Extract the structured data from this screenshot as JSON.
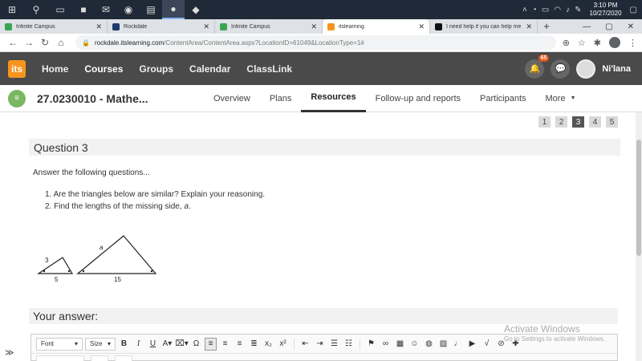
{
  "taskbar": {
    "clock_time": "3:10 PM",
    "clock_date": "10/27/2020"
  },
  "browser": {
    "tabs": [
      {
        "title": "Infinite Campus",
        "color": "#3aa655"
      },
      {
        "title": "Rockdale",
        "color": "#1d3b6e"
      },
      {
        "title": "Infinite Campus",
        "color": "#3aa655"
      },
      {
        "title": "itslearning",
        "color": "#f7941d",
        "active": true
      },
      {
        "title": "I need help if you can help me",
        "color": "#111111"
      }
    ],
    "url_host": "rockdale.itslearning.com",
    "url_path": "/ContentArea/ContentArea.aspx?LocationID=61049&LocationType=1#"
  },
  "topnav": {
    "logo_text": "its",
    "items": [
      "Home",
      "Courses",
      "Groups",
      "Calendar",
      "ClassLink"
    ],
    "notifications_count": "65",
    "user_name": "Ni'lana"
  },
  "course": {
    "title": "27.0230010 - Mathe...",
    "tabs": [
      "Overview",
      "Plans",
      "Resources",
      "Follow-up and reports",
      "Participants",
      "More"
    ]
  },
  "pager": [
    "1",
    "2",
    "3",
    "4",
    "5"
  ],
  "question": {
    "heading": "Question 3",
    "intro": "Answer the following questions...",
    "item1": "1. Are the triangles below are similar? Explain your reasoning.",
    "item2_prefix": "2. Find the lengths of the missing side, ",
    "item2_var": "a",
    "item2_suffix": ".",
    "small_triangle": {
      "side": "3",
      "base": "5"
    },
    "large_triangle": {
      "side": "a",
      "base": "15"
    }
  },
  "answer": {
    "heading": "Your answer:",
    "font_label": "Font",
    "size_label": "Size"
  },
  "watermark": {
    "line1": "Activate Windows",
    "line2": "Go to Settings to activate Windows."
  }
}
